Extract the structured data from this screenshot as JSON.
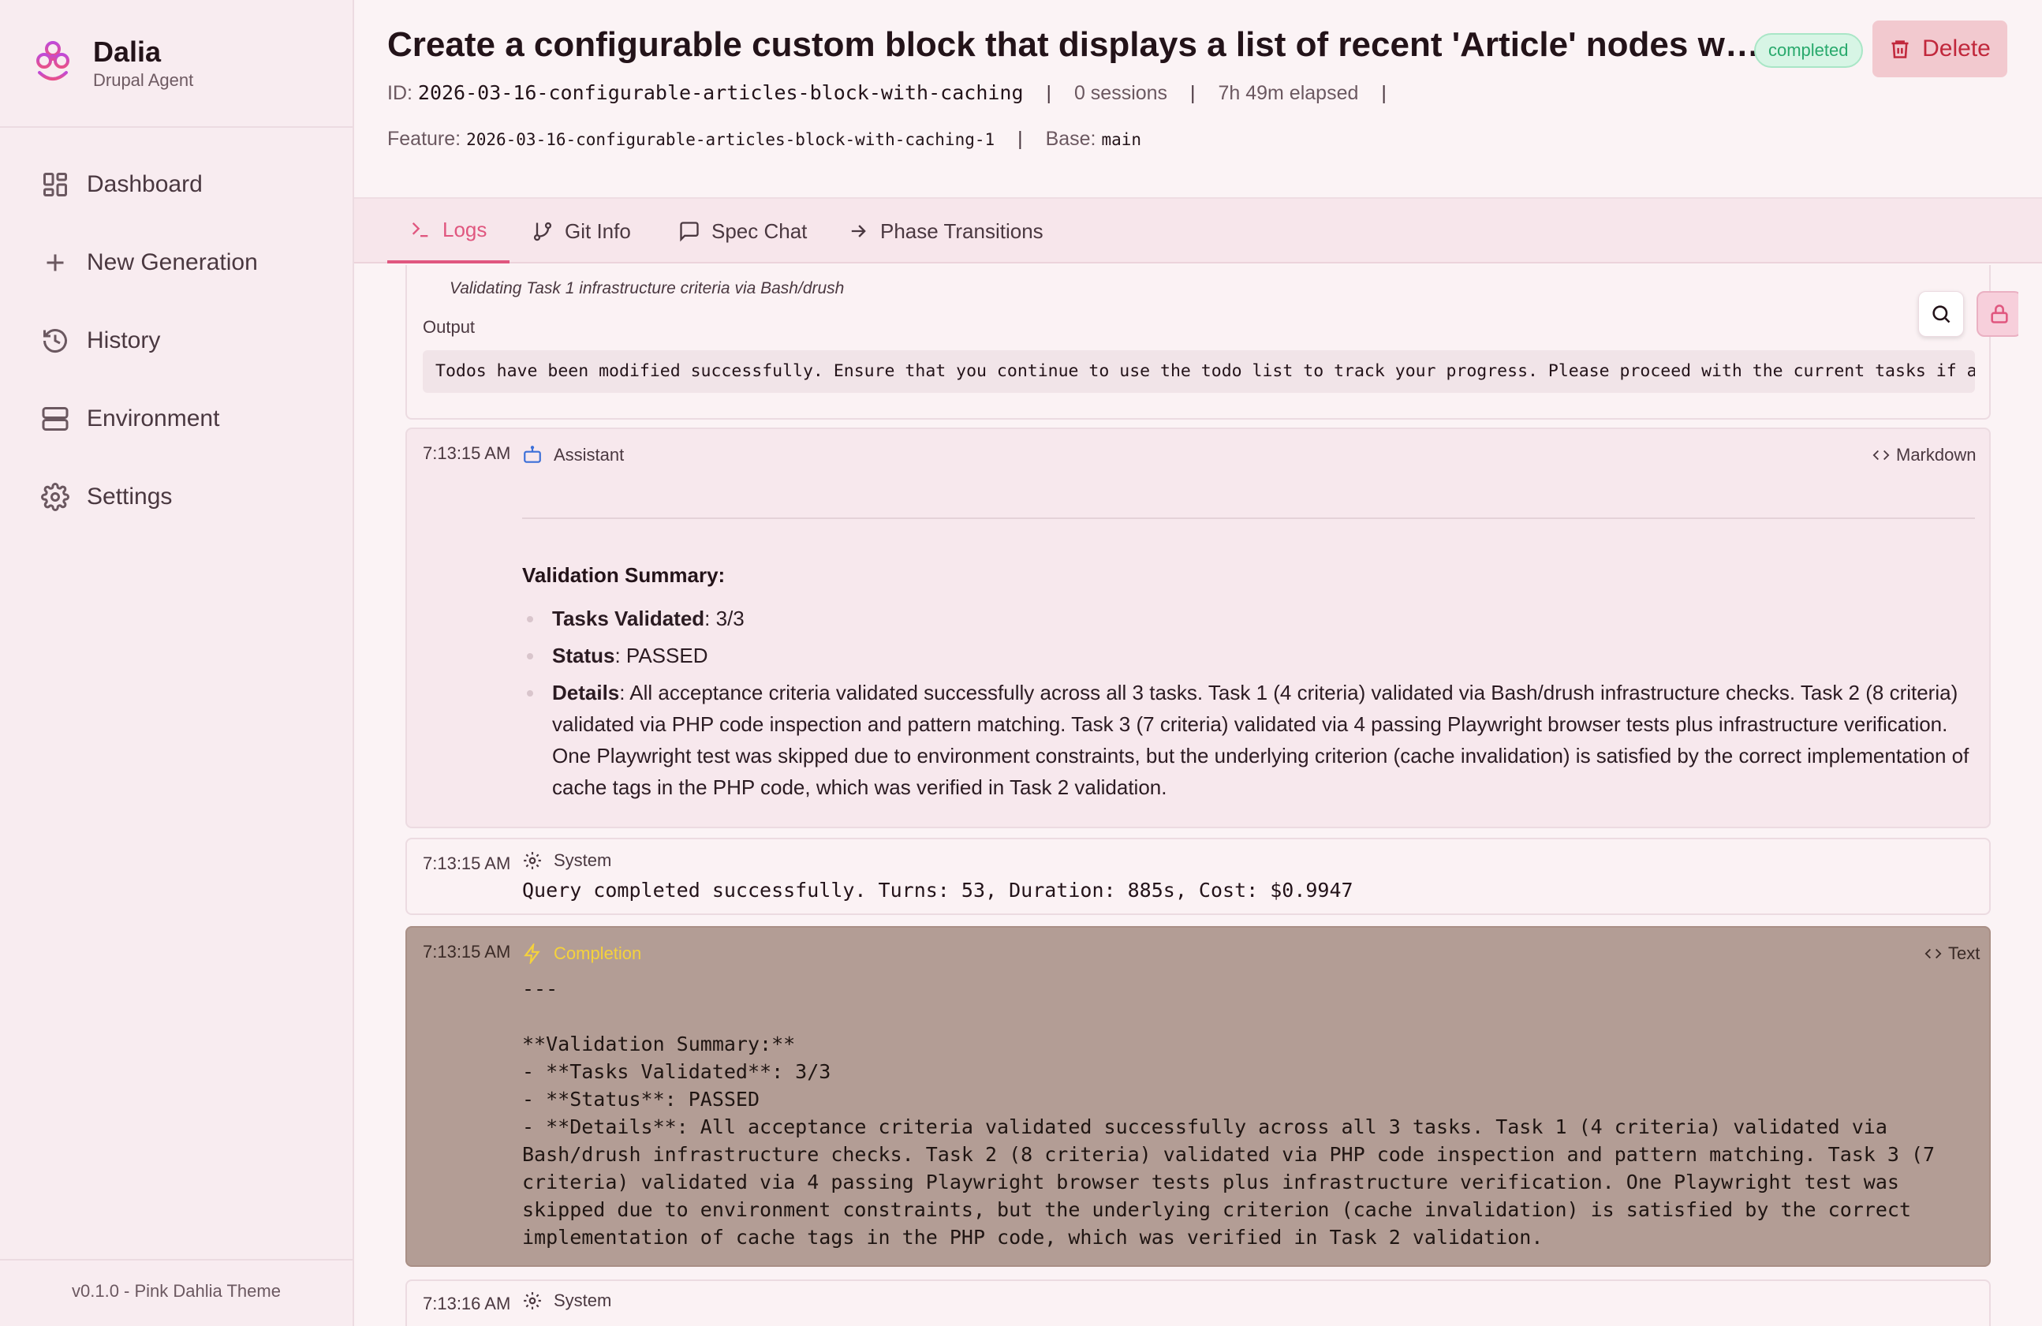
{
  "sidebar": {
    "brand_name": "Dalia",
    "brand_sub": "Drupal Agent",
    "items": [
      {
        "label": "Dashboard",
        "icon": "dashboard-icon"
      },
      {
        "label": "New Generation",
        "icon": "plus-icon"
      },
      {
        "label": "History",
        "icon": "history-icon"
      },
      {
        "label": "Environment",
        "icon": "server-icon"
      },
      {
        "label": "Settings",
        "icon": "gear-icon"
      }
    ],
    "version": "v0.1.0 - Pink Dahlia Theme"
  },
  "header": {
    "title": "Create a configurable custom block that displays a list of recent 'Article' nodes with caching",
    "status": "completed",
    "delete_label": "Delete",
    "id_label": "ID:",
    "id_value": "2026-03-16-configurable-articles-block-with-caching",
    "sessions": "0 sessions",
    "elapsed": "7h 49m elapsed",
    "feature_label": "Feature:",
    "feature_value": "2026-03-16-configurable-articles-block-with-caching-1",
    "base_label": "Base:",
    "base_value": "main",
    "separator": "|"
  },
  "tabs": [
    {
      "label": "Logs",
      "icon": "terminal-icon",
      "active": true
    },
    {
      "label": "Git Info",
      "icon": "git-branch-icon",
      "active": false
    },
    {
      "label": "Spec Chat",
      "icon": "chat-icon",
      "active": false
    },
    {
      "label": "Phase Transitions",
      "icon": "arrow-right-icon",
      "active": false
    }
  ],
  "logs": {
    "tool_output": {
      "description": "Validating Task 1 infrastructure criteria via Bash/drush",
      "output_label": "Output",
      "output_text": "Todos have been modified successfully. Ensure that you continue to use the todo list to track your progress. Please proceed with the current tasks if applicable"
    },
    "assistant": {
      "time": "7:13:15 AM",
      "role": "Assistant",
      "format_label": "Markdown",
      "summary_title": "Validation Summary:",
      "bullets": [
        {
          "key": "Tasks Validated",
          "value": ": 3/3"
        },
        {
          "key": "Status",
          "value": ": PASSED"
        },
        {
          "key": "Details",
          "value": ": All acceptance criteria validated successfully across all 3 tasks. Task 1 (4 criteria) validated via Bash/drush infrastructure checks. Task 2 (8 criteria) validated via PHP code inspection and pattern matching. Task 3 (7 criteria) validated via 4 passing Playwright browser tests plus infrastructure verification. One Playwright test was skipped due to environment constraints, but the underlying criterion (cache invalidation) is satisfied by the correct implementation of cache tags in the PHP code, which was verified in Task 2 validation."
        }
      ]
    },
    "system": {
      "time": "7:13:15 AM",
      "role": "System",
      "text": "Query completed successfully. Turns: 53, Duration: 885s, Cost: $0.9947"
    },
    "completion": {
      "time": "7:13:15 AM",
      "role": "Completion",
      "format_label": "Text",
      "text": "---\n\n**Validation Summary:**\n- **Tasks Validated**: 3/3\n- **Status**: PASSED\n- **Details**: All acceptance criteria validated successfully across all 3 tasks. Task 1 (4 criteria) validated via Bash/drush infrastructure checks. Task 2 (8 criteria) validated via PHP code inspection and pattern matching. Task 3 (7 criteria) validated via 4 passing Playwright browser tests plus infrastructure verification. One Playwright test was skipped due to environment constraints, but the underlying criterion (cache invalidation) is satisfied by the correct implementation of cache tags in the PHP code, which was verified in Task 2 validation."
    },
    "system2": {
      "time": "7:13:16 AM",
      "role": "System"
    }
  },
  "colors": {
    "accent": "#e0577f",
    "status_completed": "#28a96c",
    "danger": "#c1283c",
    "completion_bg": "#b39d95",
    "completion_label": "#f5d23c"
  }
}
